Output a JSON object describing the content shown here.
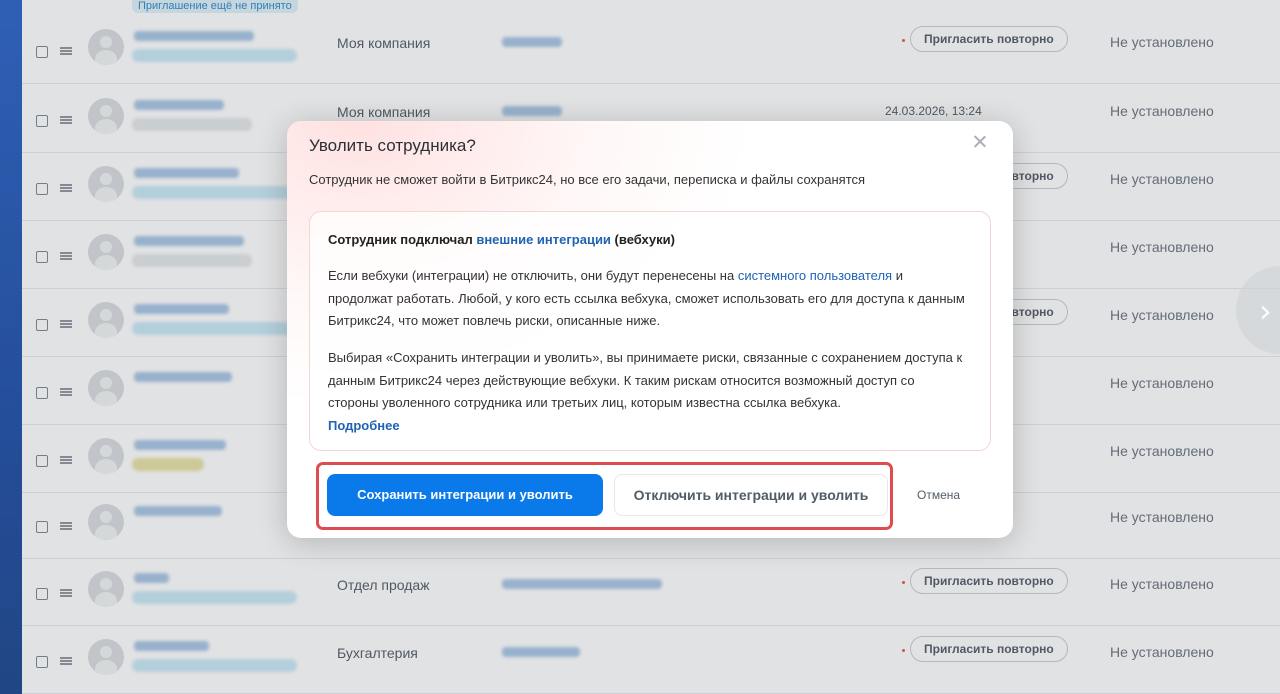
{
  "background_table": {
    "top_badge": "Приглашение ещё не принято",
    "rows": [
      {
        "dept": "Моя компания",
        "action": "Пригласить повторно",
        "status": "Не установлено"
      },
      {
        "dept": "Моя компания",
        "date": "24.03.2026, 13:24",
        "status": "Не установлено"
      },
      {
        "dept": "",
        "action": "Пригласить повторно",
        "status": "Не установлено"
      },
      {
        "dept": "",
        "status": "Не установлено"
      },
      {
        "dept": "",
        "action": "Пригласить повторно",
        "status": "Не установлено"
      },
      {
        "dept": "",
        "status": "Не установлено"
      },
      {
        "dept": "",
        "status": "Не установлено"
      },
      {
        "dept": "",
        "status": "Не установлено"
      },
      {
        "dept": "Отдел продаж",
        "action": "Пригласить повторно",
        "status": "Не установлено"
      },
      {
        "dept": "Бухгалтерия",
        "action": "Пригласить повторно",
        "status": "Не установлено"
      }
    ]
  },
  "modal": {
    "title": "Уволить сотрудника?",
    "subtitle": "Сотрудник не сможет войти в Битрикс24, но все его задачи, переписка и файлы сохранятся",
    "card": {
      "heading_before": "Сотрудник подключал ",
      "heading_link": "внешние интеграции",
      "heading_after": " (вебхуки)",
      "p1_before": "Если вебхуки (интеграции) не отключить, они будут перенесены на ",
      "p1_link": "системного пользователя",
      "p1_after": " и продолжат работать. Любой, у кого есть ссылка вебхука, сможет использовать его для доступа к данным Битрикс24, что может повлечь риски, описанные ниже.",
      "p2_text": "Выбирая «Сохранить интеграции и уволить», вы принимаете риски, связанные с сохранением доступа к данным Битрикс24 через действующие вебхуки. К таким рискам относится возможный доступ со стороны уволенного сотрудника или третьих лиц, которым известна ссылка вебхука.",
      "more_link": "Подробнее"
    },
    "buttons": {
      "primary": "Сохранить интеграции и уволить",
      "secondary": "Отключить интеграции и уволить",
      "cancel": "Отмена"
    }
  },
  "colors": {
    "primary": "#0a79ea",
    "link": "#1f63b3",
    "highlight": "#e04b4f",
    "sidebar": "#2b64c9"
  },
  "icons": [
    "checkbox",
    "drag-handle-icon",
    "avatar-placeholder-icon",
    "close-icon",
    "chevron-right-icon"
  ]
}
